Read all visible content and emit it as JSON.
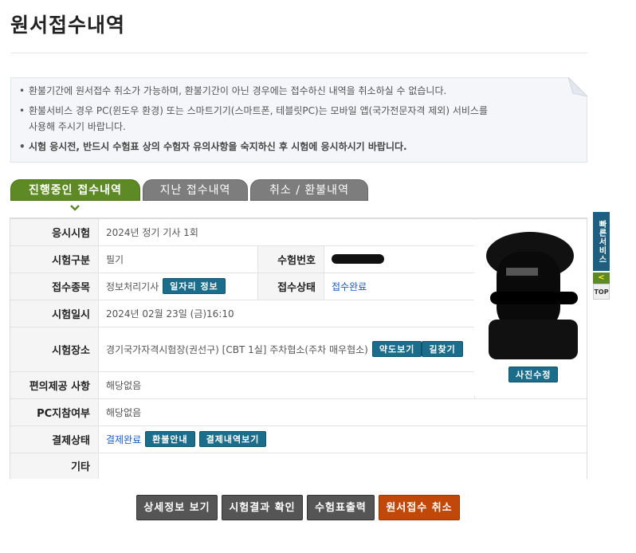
{
  "page": {
    "title": "원서접수내역"
  },
  "notice": {
    "items": [
      "환불기간에 원서접수 취소가 가능하며, 환불기간이 아닌 경우에는 접수하신 내역을 취소하실 수 없습니다.",
      "환불서비스 경우 PC(윈도우 환경) 또는 스마트기기(스마트폰, 테블릿PC)는 모바일 앱(국가전문자격 제외) 서비스를",
      "사용해 주시기 바랍니다.",
      "시험 응시전, 반드시 수험표 상의 수험자 유의사항을 숙지하신 후 시험에 응시하시기 바랍니다."
    ]
  },
  "tabs": [
    {
      "label": "진행중인 접수내역",
      "active": true
    },
    {
      "label": "지난 접수내역",
      "active": false
    },
    {
      "label": "취소 / 환불내역",
      "active": false
    }
  ],
  "details": {
    "exam_label": "응시시험",
    "exam_value": "2024년 정기 기사 1회",
    "type_label": "시험구분",
    "type_value": "필기",
    "number_label": "수험번호",
    "category_label": "접수종목",
    "category_value": "정보처리기사",
    "job_info_btn": "일자리 정보",
    "status_label": "접수상태",
    "status_value": "접수완료",
    "date_label": "시험일시",
    "date_value": "2024년 02월 23일 (금)16:10",
    "venue_label": "시험장소",
    "venue_value": "경기국가자격시험장(권선구) [CBT 1실] 주차협소(주차 매우협소)",
    "map_btn": "약도보기",
    "route_btn": "길찾기",
    "convenience_label": "편의제공 사항",
    "convenience_value": "해당없음",
    "pc_label": "PC지참여부",
    "pc_value": "해당없음",
    "payment_label": "결제상태",
    "payment_value": "결제완료",
    "refund_btn": "환불안내",
    "payment_history_btn": "결제내역보기",
    "etc_label": "기타"
  },
  "photo": {
    "edit_btn": "사진수정"
  },
  "side_nav": {
    "quick_label": "빠른서비스",
    "arrow": "<",
    "top_label": "TOP"
  },
  "actions": {
    "detail": "상세정보 보기",
    "result": "시험결과 확인",
    "ticket": "수험표출력",
    "cancel": "원서접수 취소"
  },
  "colors": {
    "tab_active": "#5e8a25",
    "tab_inactive": "#7d7d7d",
    "button_blue": "#1b6d8c",
    "cancel_orange": "#c2480a",
    "link_blue": "#1a5bc2"
  }
}
